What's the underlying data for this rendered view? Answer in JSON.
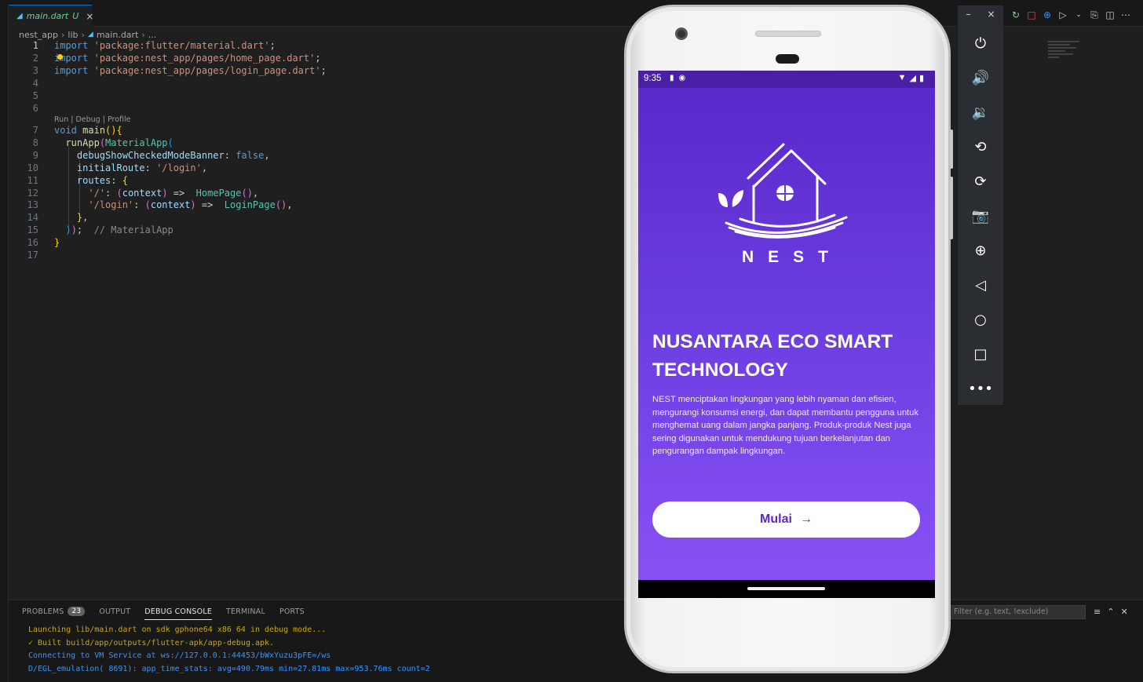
{
  "editor": {
    "tab": {
      "filename": "main.dart",
      "status": "U",
      "close": "×"
    },
    "breadcrumb": [
      "nest_app",
      "lib",
      "main.dart",
      "..."
    ],
    "codelens": "Run | Debug | Profile",
    "line_numbers": [
      "1",
      "2",
      "3",
      "4",
      "5",
      "6",
      "7",
      "8",
      "9",
      "10",
      "11",
      "12",
      "13",
      "14",
      "15",
      "16",
      "17"
    ]
  },
  "panel": {
    "tabs": [
      {
        "label": "PROBLEMS",
        "badge": "23"
      },
      {
        "label": "OUTPUT"
      },
      {
        "label": "DEBUG CONSOLE"
      },
      {
        "label": "TERMINAL"
      },
      {
        "label": "PORTS"
      }
    ],
    "filter_placeholder": "Filter (e.g. text, !exclude)",
    "console": [
      "Launching lib/main.dart on sdk gphone64 x86 64 in debug mode...",
      "✓  Built build/app/outputs/flutter-apk/app-debug.apk.",
      "Connecting to VM Service at ws://127.0.0.1:44453/bWxYuzu3pFE=/ws",
      "D/EGL_emulation( 8691): app_time_stats: avg=490.79ms min=27.81ms max=953.76ms count=2"
    ]
  },
  "phone": {
    "status_time": "9:35",
    "brand": "NEST",
    "headline": "NUSANTARA ECO SMART TECHNOLOGY",
    "description": "NEST menciptakan lingkungan yang lebih nyaman dan efisien, mengurangi konsumsi energi, dan dapat membantu pengguna untuk menghemat uang dalam jangka panjang. Produk-produk Nest juga sering digunakan untuk mendukung tujuan berkelanjutan dan pengurangan dampak lingkungan.",
    "cta_label": "Mulai",
    "colors": {
      "gradient_top": "#5a27c8",
      "gradient_bottom": "#8a52f5",
      "status_bar": "#4a1fa5"
    }
  },
  "emulator_toolbar": {
    "window_controls": [
      "–",
      "×"
    ],
    "buttons": [
      "power-icon",
      "volume-up-icon",
      "volume-down-icon",
      "rotate-left-icon",
      "rotate-right-icon",
      "camera-icon",
      "zoom-icon",
      "back-icon",
      "home-icon",
      "overview-icon",
      "more-icon"
    ]
  }
}
